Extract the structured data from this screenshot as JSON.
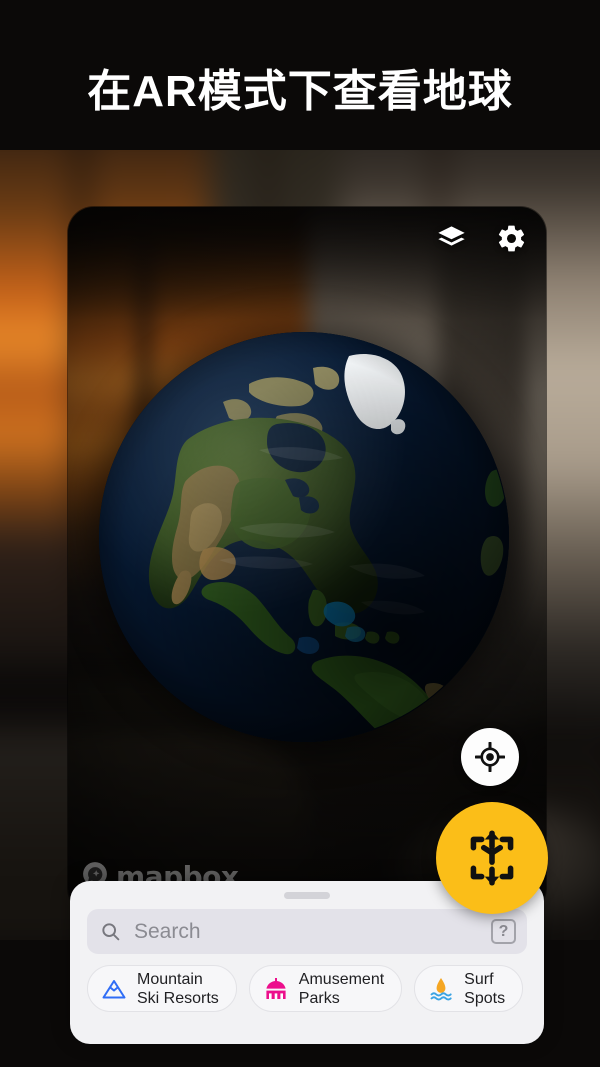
{
  "headline": "在AR模式下查看地球",
  "map_controls": [
    {
      "name": "layers-icon",
      "label": "Layers"
    },
    {
      "name": "gear-icon",
      "label": "Settings"
    }
  ],
  "attribution": {
    "brand": "mapbox",
    "logo_icon": "mapbox-logo-icon"
  },
  "buttons": {
    "locate": {
      "icon": "locate-crosshair-icon",
      "label": "Locate me"
    },
    "ar": {
      "icon": "ar-cube-icon",
      "label": "AR",
      "color": "#fbbe18"
    }
  },
  "globe": {
    "view": "satellite",
    "region": "North America"
  },
  "bottom_sheet": {
    "grabber": "drag-handle",
    "search": {
      "placeholder": "Search",
      "value": "",
      "icon": "search-icon",
      "shortcut_hint": "?"
    },
    "chips": [
      {
        "label": "Mountain\nSki Resorts",
        "icon": "mountain-icon",
        "color": "#2f6df6"
      },
      {
        "label": "Amusement\nParks",
        "icon": "carousel-tent-icon",
        "color": "#ec0f8c"
      },
      {
        "label": "Surf\nSpots",
        "icon": "surf-wave-icon",
        "color": "#f5a623"
      }
    ]
  }
}
